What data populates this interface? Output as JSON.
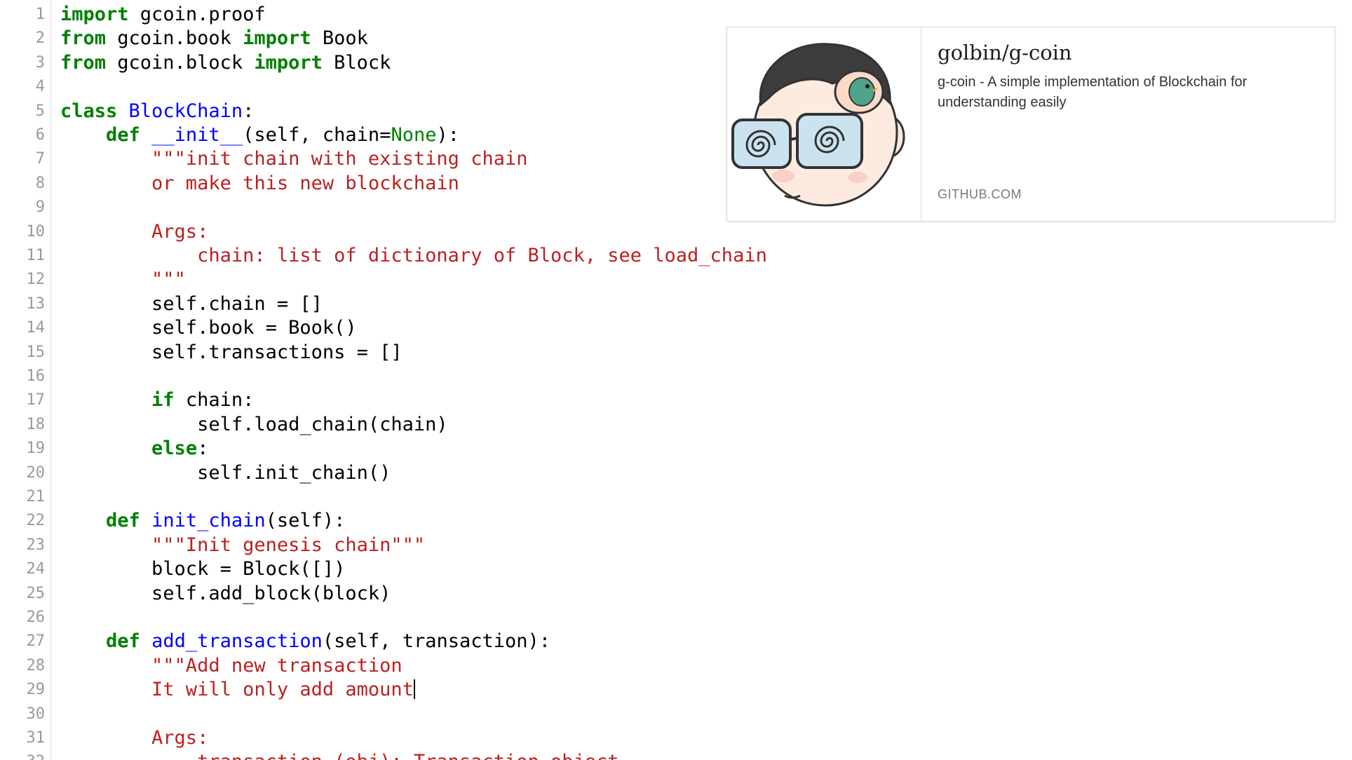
{
  "editor": {
    "lines": [
      {
        "n": "1",
        "tokens": [
          {
            "t": "kw",
            "v": "import"
          },
          {
            "t": "plain",
            "v": " gcoin.proof"
          }
        ]
      },
      {
        "n": "2",
        "tokens": [
          {
            "t": "kw",
            "v": "from"
          },
          {
            "t": "plain",
            "v": " gcoin.book "
          },
          {
            "t": "kw",
            "v": "import"
          },
          {
            "t": "plain",
            "v": " Book"
          }
        ]
      },
      {
        "n": "3",
        "tokens": [
          {
            "t": "kw",
            "v": "from"
          },
          {
            "t": "plain",
            "v": " gcoin.block "
          },
          {
            "t": "kw",
            "v": "import"
          },
          {
            "t": "plain",
            "v": " Block"
          }
        ]
      },
      {
        "n": "4",
        "tokens": []
      },
      {
        "n": "5",
        "tokens": [
          {
            "t": "kw",
            "v": "class"
          },
          {
            "t": "plain",
            "v": " "
          },
          {
            "t": "def-name",
            "v": "BlockChain"
          },
          {
            "t": "plain",
            "v": ":"
          }
        ]
      },
      {
        "n": "6",
        "tokens": [
          {
            "t": "plain",
            "v": "    "
          },
          {
            "t": "kw",
            "v": "def"
          },
          {
            "t": "plain",
            "v": " "
          },
          {
            "t": "def-name",
            "v": "__init__"
          },
          {
            "t": "plain",
            "v": "(self, chain="
          },
          {
            "t": "builtin",
            "v": "None"
          },
          {
            "t": "plain",
            "v": "):"
          }
        ]
      },
      {
        "n": "7",
        "tokens": [
          {
            "t": "str",
            "v": "        \"\"\"init chain with existing chain"
          }
        ]
      },
      {
        "n": "8",
        "tokens": [
          {
            "t": "str",
            "v": "        or make this new blockchain"
          }
        ]
      },
      {
        "n": "9",
        "tokens": []
      },
      {
        "n": "10",
        "tokens": [
          {
            "t": "str",
            "v": "        Args:"
          }
        ]
      },
      {
        "n": "11",
        "tokens": [
          {
            "t": "str",
            "v": "            chain: list of dictionary of Block, see load_chain"
          }
        ]
      },
      {
        "n": "12",
        "tokens": [
          {
            "t": "str",
            "v": "        \"\"\""
          }
        ]
      },
      {
        "n": "13",
        "tokens": [
          {
            "t": "plain",
            "v": "        self.chain = []"
          }
        ]
      },
      {
        "n": "14",
        "tokens": [
          {
            "t": "plain",
            "v": "        self.book = Book()"
          }
        ]
      },
      {
        "n": "15",
        "tokens": [
          {
            "t": "plain",
            "v": "        self.transactions = []"
          }
        ]
      },
      {
        "n": "16",
        "tokens": []
      },
      {
        "n": "17",
        "tokens": [
          {
            "t": "plain",
            "v": "        "
          },
          {
            "t": "kw",
            "v": "if"
          },
          {
            "t": "plain",
            "v": " chain:"
          }
        ]
      },
      {
        "n": "18",
        "tokens": [
          {
            "t": "plain",
            "v": "            self.load_chain(chain)"
          }
        ]
      },
      {
        "n": "19",
        "tokens": [
          {
            "t": "plain",
            "v": "        "
          },
          {
            "t": "kw",
            "v": "else"
          },
          {
            "t": "plain",
            "v": ":"
          }
        ]
      },
      {
        "n": "20",
        "tokens": [
          {
            "t": "plain",
            "v": "            self.init_chain()"
          }
        ]
      },
      {
        "n": "21",
        "tokens": []
      },
      {
        "n": "22",
        "tokens": [
          {
            "t": "plain",
            "v": "    "
          },
          {
            "t": "kw",
            "v": "def"
          },
          {
            "t": "plain",
            "v": " "
          },
          {
            "t": "def-name",
            "v": "init_chain"
          },
          {
            "t": "plain",
            "v": "(self):"
          }
        ]
      },
      {
        "n": "23",
        "tokens": [
          {
            "t": "str",
            "v": "        \"\"\"Init genesis chain\"\"\""
          }
        ]
      },
      {
        "n": "24",
        "tokens": [
          {
            "t": "plain",
            "v": "        block = Block([])"
          }
        ]
      },
      {
        "n": "25",
        "tokens": [
          {
            "t": "plain",
            "v": "        self.add_block(block)"
          }
        ]
      },
      {
        "n": "26",
        "tokens": []
      },
      {
        "n": "27",
        "tokens": [
          {
            "t": "plain",
            "v": "    "
          },
          {
            "t": "kw",
            "v": "def"
          },
          {
            "t": "plain",
            "v": " "
          },
          {
            "t": "def-name",
            "v": "add_transaction"
          },
          {
            "t": "plain",
            "v": "(self, transaction):"
          }
        ]
      },
      {
        "n": "28",
        "tokens": [
          {
            "t": "str",
            "v": "        \"\"\"Add new transaction"
          }
        ]
      },
      {
        "n": "29",
        "tokens": [
          {
            "t": "str",
            "v": "        It will only add amount"
          }
        ],
        "cursor": true
      },
      {
        "n": "30",
        "tokens": []
      },
      {
        "n": "31",
        "tokens": [
          {
            "t": "str",
            "v": "        Args:"
          }
        ]
      },
      {
        "n": "32",
        "tokens": [
          {
            "t": "str",
            "v": "            transaction (obj): Transaction object"
          }
        ]
      }
    ]
  },
  "link_card": {
    "title": "golbin/g-coin",
    "description": "g-coin - A simple implementation of Blockchain for understanding easily",
    "domain": "GITHUB.COM",
    "thumbnail_icon": "avatar-illustration"
  }
}
